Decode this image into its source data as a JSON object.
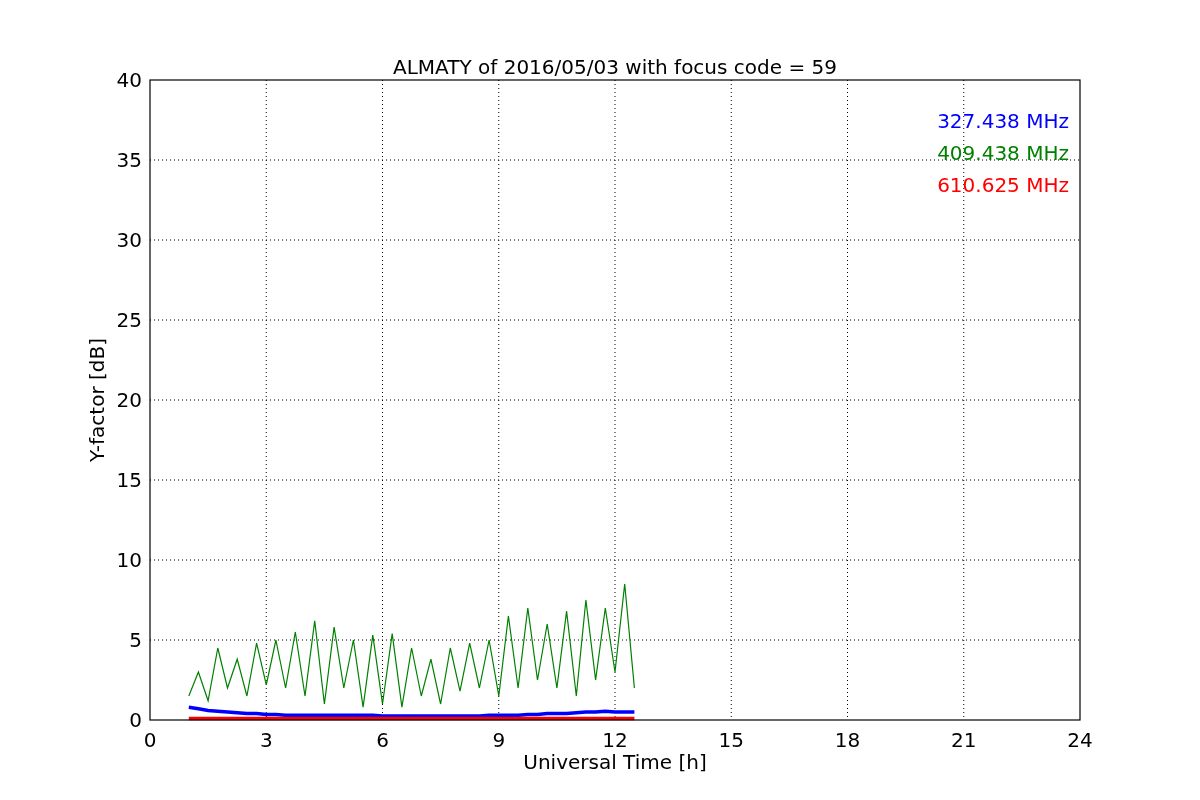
{
  "figure": {
    "chart_data": {
      "type": "line",
      "title": "ALMATY of 2016/05/03 with focus code = 59",
      "xlabel": "Universal Time [h]",
      "ylabel": "Y-factor [dB]",
      "x": [
        1,
        1.25,
        1.5,
        1.75,
        2,
        2.25,
        2.5,
        2.75,
        3,
        3.25,
        3.5,
        3.75,
        4,
        4.25,
        4.5,
        4.75,
        5,
        5.25,
        5.5,
        5.75,
        6,
        6.25,
        6.5,
        6.75,
        7,
        7.25,
        7.5,
        7.75,
        8,
        8.25,
        8.5,
        8.75,
        9,
        9.25,
        9.5,
        9.75,
        10,
        10.25,
        10.5,
        10.75,
        11,
        11.25,
        11.5,
        11.75,
        12,
        12.25,
        12.5
      ],
      "series": [
        {
          "name": "327.438 MHz",
          "color": "#0000ff",
          "values": [
            0.8,
            0.7,
            0.6,
            0.55,
            0.5,
            0.45,
            0.4,
            0.4,
            0.35,
            0.35,
            0.3,
            0.3,
            0.3,
            0.3,
            0.3,
            0.3,
            0.3,
            0.3,
            0.3,
            0.3,
            0.25,
            0.25,
            0.25,
            0.25,
            0.25,
            0.25,
            0.25,
            0.25,
            0.25,
            0.25,
            0.25,
            0.3,
            0.3,
            0.3,
            0.3,
            0.35,
            0.35,
            0.4,
            0.4,
            0.4,
            0.45,
            0.5,
            0.5,
            0.55,
            0.5,
            0.5,
            0.5
          ]
        },
        {
          "name": "409.438 MHz",
          "color": "#008000",
          "values": [
            1.5,
            3.0,
            1.2,
            4.5,
            2.0,
            3.8,
            1.5,
            4.8,
            2.2,
            5.0,
            2.0,
            5.5,
            1.5,
            6.2,
            1.0,
            5.8,
            2.0,
            5.0,
            0.8,
            5.3,
            1.0,
            5.4,
            0.8,
            4.5,
            1.5,
            3.8,
            1.0,
            4.5,
            1.8,
            4.8,
            2.0,
            5.0,
            1.5,
            6.5,
            2.0,
            7.0,
            2.5,
            6.0,
            2.0,
            6.8,
            1.5,
            7.5,
            2.5,
            7.0,
            3.0,
            8.5,
            2.0
          ]
        },
        {
          "name": "610.625 MHz",
          "color": "#ff0000",
          "values": [
            0.1,
            0.1,
            0.1,
            0.1,
            0.1,
            0.1,
            0.1,
            0.1,
            0.1,
            0.1,
            0.1,
            0.1,
            0.1,
            0.1,
            0.1,
            0.1,
            0.1,
            0.1,
            0.1,
            0.1,
            0.1,
            0.1,
            0.1,
            0.1,
            0.1,
            0.1,
            0.1,
            0.1,
            0.1,
            0.1,
            0.1,
            0.1,
            0.1,
            0.1,
            0.1,
            0.1,
            0.1,
            0.1,
            0.1,
            0.1,
            0.1,
            0.1,
            0.1,
            0.1,
            0.1,
            0.1,
            0.1
          ]
        }
      ],
      "xlim": [
        0,
        24
      ],
      "ylim": [
        0,
        40
      ],
      "xticks": [
        0,
        3,
        6,
        9,
        12,
        15,
        18,
        21,
        24
      ],
      "yticks": [
        0,
        5,
        10,
        15,
        20,
        25,
        30,
        35,
        40
      ],
      "grid": true
    }
  }
}
